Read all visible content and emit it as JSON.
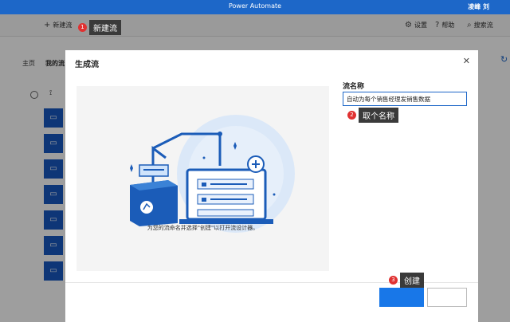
{
  "app": {
    "title": "Power Automate",
    "user": "凌峰 刘"
  },
  "toolbar": {
    "new_flow": "新建流",
    "settings": "设置",
    "help": "帮助",
    "search": "搜索流"
  },
  "background": {
    "tabs": [
      "主页",
      "我的流"
    ]
  },
  "dialog": {
    "title": "生成流",
    "field_label": "流名称",
    "field_value": "自动为每个销售经理发销售数据",
    "caption": "为您的流命名并选择\"创建\"以打开流设计器。"
  },
  "callouts": [
    {
      "num": "1",
      "text": "新建流"
    },
    {
      "num": "2",
      "text": "取个名称"
    },
    {
      "num": "3",
      "text": "创建"
    }
  ],
  "colors": {
    "accent": "#1d67c8",
    "button": "#1877e8",
    "callout_badge": "#e03131"
  }
}
